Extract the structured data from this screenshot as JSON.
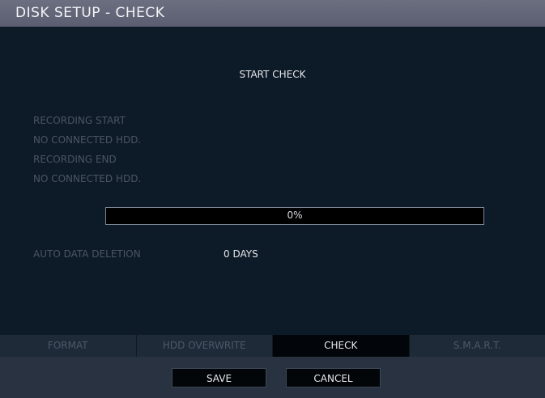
{
  "window": {
    "title": "DISK SETUP - CHECK"
  },
  "main": {
    "start_check_label": "START CHECK",
    "info_lines": [
      "RECORDING START",
      "NO CONNECTED HDD.",
      "RECORDING END",
      "NO CONNECTED HDD."
    ],
    "progress": {
      "value": 0,
      "label": "0%"
    },
    "auto_data_deletion": {
      "label": "AUTO DATA DELETION",
      "value": "0 DAYS"
    }
  },
  "tabs": [
    {
      "label": "FORMAT",
      "active": false
    },
    {
      "label": "HDD OVERWRITE",
      "active": false
    },
    {
      "label": "CHECK",
      "active": true
    },
    {
      "label": "S.M.A.R.T.",
      "active": false
    }
  ],
  "footer": {
    "save_label": "SAVE",
    "cancel_label": "CANCEL"
  },
  "colors": {
    "title_bar": "#5f6375",
    "background": "#0d1a27",
    "active_tab": "#02050a",
    "inactive_tab": "#1e2a38",
    "footer": "#293241"
  }
}
